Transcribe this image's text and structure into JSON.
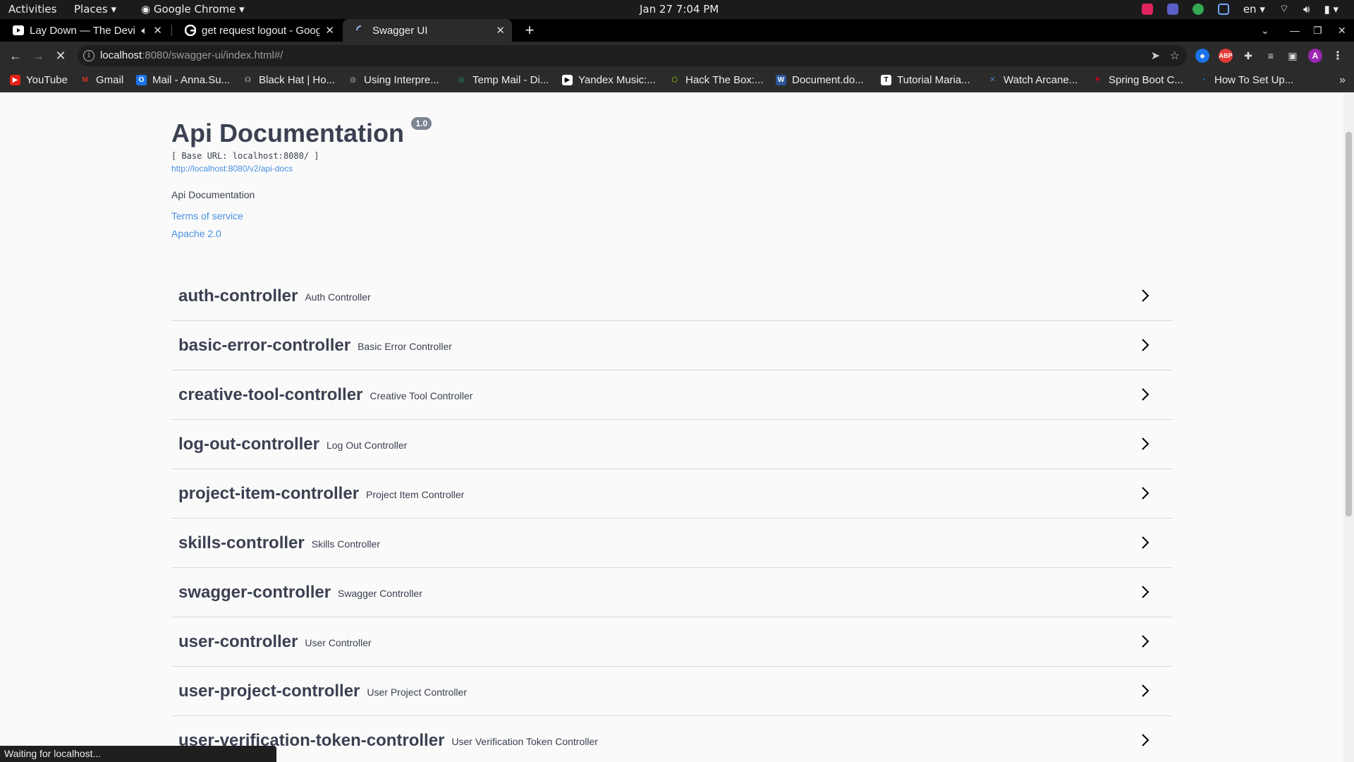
{
  "system_bar": {
    "activities": "Activities",
    "places": "Places",
    "app": "Google Chrome",
    "clock": "Jan 27  7:04 PM",
    "lang": "en"
  },
  "tabs": [
    {
      "title": "Lay Down — The Devil",
      "icon": "youtube-play-icon",
      "audio": true
    },
    {
      "title": "get request logout - Goog",
      "icon": "google-icon"
    },
    {
      "title": "Swagger UI",
      "icon": "loading-spinner-icon",
      "active": true
    }
  ],
  "toolbar": {
    "url_host": "localhost",
    "url_path": ":8080/swagger-ui/index.html#/"
  },
  "bookmarks": [
    {
      "label": "YouTube",
      "color": "#e62117"
    },
    {
      "label": "Gmail",
      "color": "#d93025"
    },
    {
      "label": "Mail - Anna.Su...",
      "color": "#1a73e8"
    },
    {
      "label": "Black Hat | Ho...",
      "color": "#888888"
    },
    {
      "label": "Using Interpre...",
      "color": "#777777"
    },
    {
      "label": "Temp Mail - Di...",
      "color": "#2f9c72"
    },
    {
      "label": "Yandex Music:...",
      "color": "#eeeeee"
    },
    {
      "label": "Hack The Box:...",
      "color": "#9fef00"
    },
    {
      "label": "Document.do...",
      "color": "#2b579a"
    },
    {
      "label": "Tutorial Maria...",
      "color": "#eeeeee"
    },
    {
      "label": "Watch Arcane...",
      "color": "#4b8bd6"
    },
    {
      "label": "Spring Boot C...",
      "color": "#d0021b"
    },
    {
      "label": "How To Set Up...",
      "color": "#1a73e8"
    }
  ],
  "info": {
    "title": "Api Documentation",
    "version": "1.0",
    "base_url": "[ Base URL: localhost:8080/ ]",
    "api_docs_link": "http://localhost:8080/v2/api-docs",
    "description": "Api Documentation",
    "terms": "Terms of service",
    "license": "Apache 2.0"
  },
  "controllers": [
    {
      "name": "auth-controller",
      "desc": "Auth Controller"
    },
    {
      "name": "basic-error-controller",
      "desc": "Basic Error Controller"
    },
    {
      "name": "creative-tool-controller",
      "desc": "Creative Tool Controller"
    },
    {
      "name": "log-out-controller",
      "desc": "Log Out Controller"
    },
    {
      "name": "project-item-controller",
      "desc": "Project Item Controller"
    },
    {
      "name": "skills-controller",
      "desc": "Skills Controller"
    },
    {
      "name": "swagger-controller",
      "desc": "Swagger Controller"
    },
    {
      "name": "user-controller",
      "desc": "User Controller"
    },
    {
      "name": "user-project-controller",
      "desc": "User Project Controller"
    },
    {
      "name": "user-verification-token-controller",
      "desc": "User Verification Token Controller"
    }
  ],
  "status": "Waiting for localhost..."
}
